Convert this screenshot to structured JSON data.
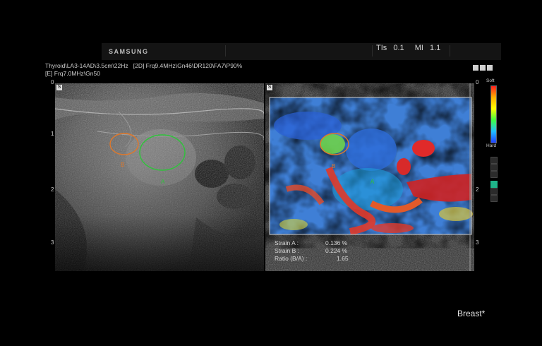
{
  "brand": "SAMSUNG",
  "header": {
    "tis_label": "TIs",
    "tis_value": "0.1",
    "mi_label": "MI",
    "mi_value": "1.1"
  },
  "info": {
    "line1_probe": "Thyroid\\LA3-14AD\\3.5cm\\22Hz",
    "line1_mode": "[2D] Frq9.4MHz\\Gn46\\DR120\\FA7\\P90%",
    "line2": "[E] Frq7.0MHz\\Gn50"
  },
  "depth_labels": [
    "0",
    "1",
    "2",
    "3"
  ],
  "panel_marker": "S",
  "roi_labels": {
    "a": "A",
    "b": "B"
  },
  "strain": {
    "a_label": "Strain A :",
    "a_value": "0.136 %",
    "b_label": "Strain B :",
    "b_value": "0.224 %",
    "ratio_label": "Ratio (B/A) :",
    "ratio_value": "1.65"
  },
  "legend": {
    "top": "Soft",
    "bottom": "Hard"
  },
  "watermark": "Breast*",
  "colors": {
    "roi_a": "#2ec43a",
    "roi_b": "#e0782a"
  }
}
